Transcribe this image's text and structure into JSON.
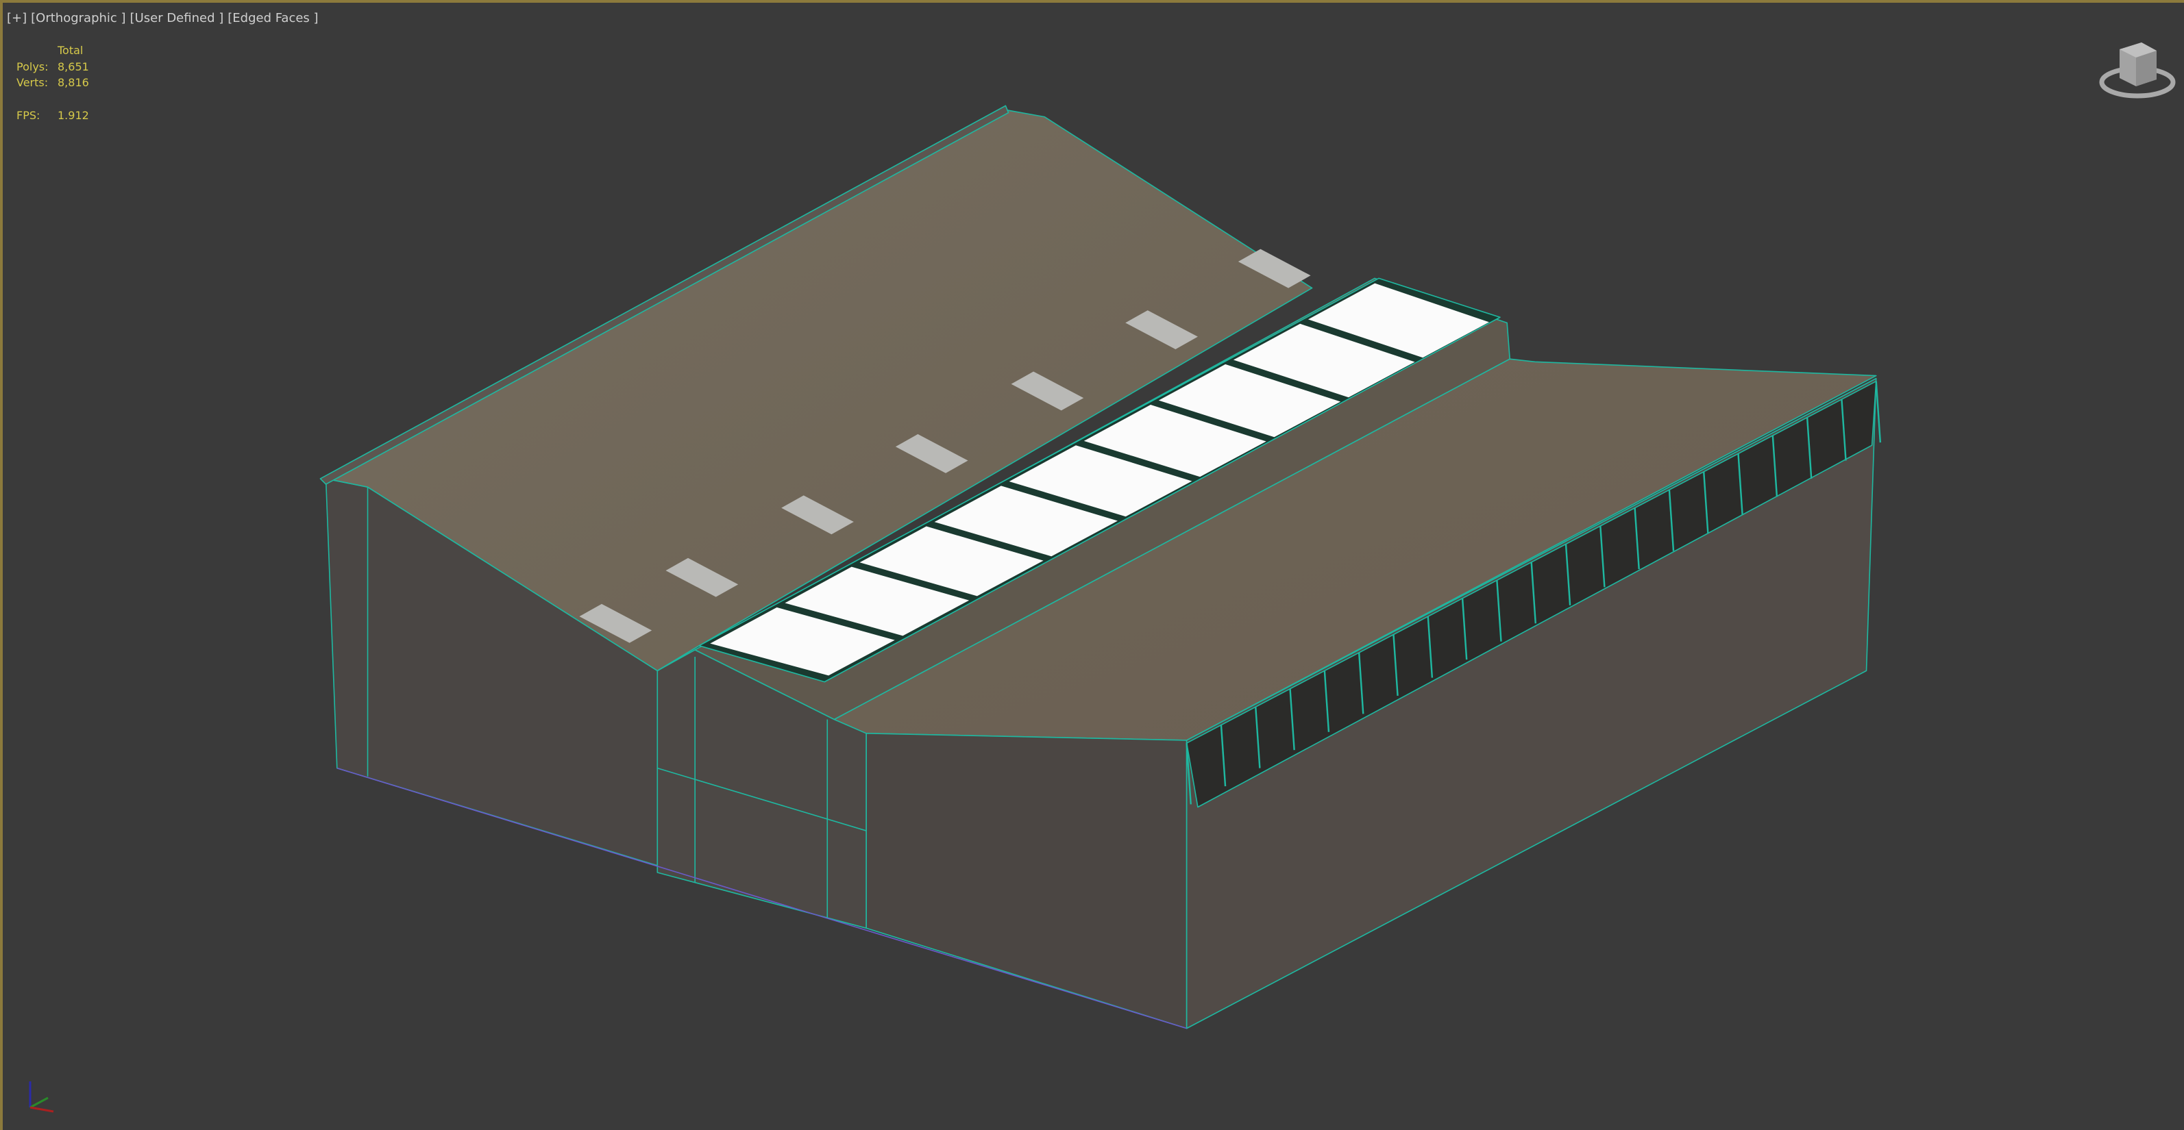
{
  "viewport": {
    "labels": [
      "[+]",
      "[Orthographic ]",
      "[User Defined ]",
      "[Edged Faces ]"
    ],
    "stats": {
      "header": "Total",
      "polys_label": "Polys:",
      "polys": "8,651",
      "verts_label": "Verts:",
      "verts": "8,816",
      "fps_label": "FPS:",
      "fps": "1.912"
    },
    "gizmo_axes": [
      "x",
      "y",
      "z"
    ]
  },
  "colors": {
    "background": "#3a3a3a",
    "active_border": "#8c7a3c",
    "stats_text": "#d6c94a",
    "edges": "#1fb7a0"
  }
}
